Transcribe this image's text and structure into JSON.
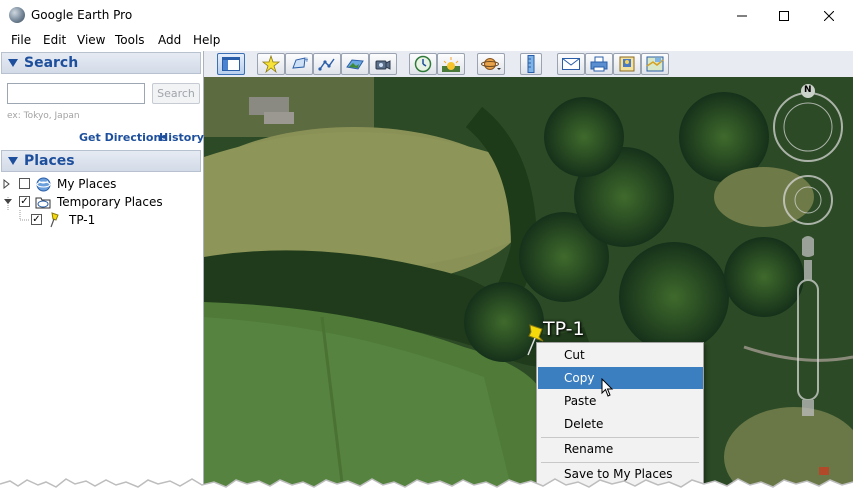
{
  "window": {
    "title": "Google Earth Pro",
    "controls": {
      "minimize": "—",
      "maximize": "☐",
      "close": "✕"
    }
  },
  "menubar": [
    "File",
    "Edit",
    "View",
    "Tools",
    "Add",
    "Help"
  ],
  "toolbar": {
    "buttons": [
      {
        "name": "sidebar-toggle-button",
        "icon": "sidebar-icon"
      },
      {
        "name": "add-placemark-button",
        "icon": "pushpin-icon"
      },
      {
        "name": "add-polygon-button",
        "icon": "polygon-icon"
      },
      {
        "name": "add-path-button",
        "icon": "path-icon"
      },
      {
        "name": "add-image-overlay-button",
        "icon": "image-overlay-icon"
      },
      {
        "name": "record-tour-button",
        "icon": "tour-camera-icon"
      },
      {
        "name": "historical-imagery-button",
        "icon": "clock-icon"
      },
      {
        "name": "sunlight-button",
        "icon": "sun-icon"
      },
      {
        "name": "switch-planet-button",
        "icon": "planet-icon"
      },
      {
        "name": "ruler-button",
        "icon": "ruler-icon"
      },
      {
        "name": "email-button",
        "icon": "envelope-icon"
      },
      {
        "name": "print-button",
        "icon": "printer-icon"
      },
      {
        "name": "save-image-button",
        "icon": "save-image-icon"
      },
      {
        "name": "view-in-maps-button",
        "icon": "maps-icon"
      }
    ]
  },
  "search": {
    "header": "Search",
    "input_value": "",
    "button_label": "Search",
    "hint": "ex: Tokyo, Japan",
    "get_directions": "Get Directions",
    "history": "History"
  },
  "places": {
    "header": "Places",
    "items": [
      {
        "label": "My Places",
        "checked": false,
        "icon": "globe-icon",
        "expanded": false
      },
      {
        "label": "Temporary Places",
        "checked": true,
        "icon": "folder-icon",
        "expanded": true
      },
      {
        "label": "TP-1",
        "checked": true,
        "icon": "pushpin-icon"
      }
    ]
  },
  "map": {
    "compass_label": "N",
    "placemark_label": "TP-1"
  },
  "context_menu": {
    "items": [
      "Cut",
      "Copy",
      "Paste",
      "Delete",
      "Rename",
      "Save to My Places"
    ],
    "active": "Copy"
  },
  "colors": {
    "accent": "#1d4f9c",
    "selection": "#3c7fc1",
    "pin": "#f5d90a"
  }
}
